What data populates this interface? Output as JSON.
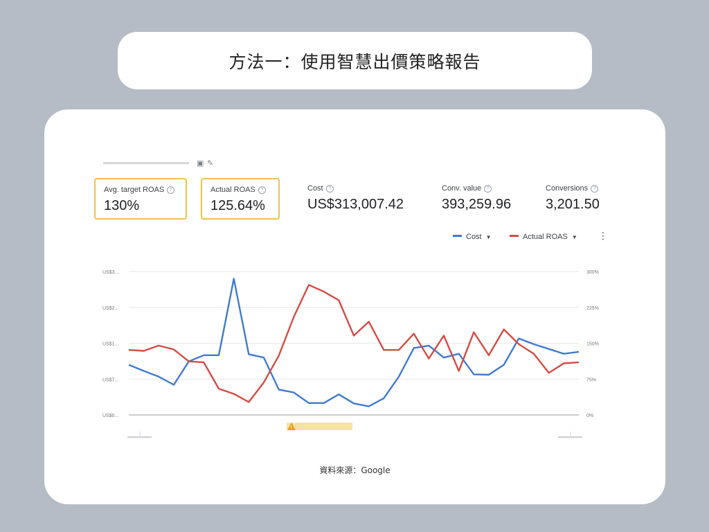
{
  "header": {
    "title": "方法一：使用智慧出價策略報告"
  },
  "icons": {
    "save": "save-icon",
    "edit": "pencil-icon",
    "help": "question-circle-icon",
    "warning": "warning-icon",
    "more": "more-vert-icon"
  },
  "metrics": [
    {
      "label": "Avg. target ROAS",
      "value": "130%",
      "highlighted": true
    },
    {
      "label": "Actual ROAS",
      "value": "125.64%",
      "highlighted": true
    },
    {
      "label": "Cost",
      "value": "US$313,007.42",
      "highlighted": false
    },
    {
      "label": "Conv. value",
      "value": "393,259.96",
      "highlighted": false
    },
    {
      "label": "Conversions",
      "value": "3,201.50",
      "highlighted": false
    }
  ],
  "legend": {
    "cost_label": "Cost",
    "roas_label": "Actual ROAS"
  },
  "colors": {
    "cost": "#3f7ad1",
    "roas": "#d64a43",
    "highlight": "#f3c04b",
    "warning": "#f5e3a6"
  },
  "chart_data": {
    "type": "line",
    "x": [
      1,
      2,
      3,
      4,
      5,
      6,
      7,
      8,
      9,
      10,
      11,
      12,
      13,
      14,
      15,
      16,
      17,
      18,
      19,
      20,
      21,
      22,
      23,
      24,
      25,
      26,
      27,
      28,
      29,
      30,
      31
    ],
    "y_left_ticks": [
      "US$0...",
      "US$7...",
      "US$1...",
      "US$2...",
      "US$3..."
    ],
    "y_right_ticks": [
      "0%",
      "75%",
      "150%",
      "225%",
      "300%"
    ],
    "ylim": [
      0,
      300
    ],
    "series": [
      {
        "name": "Cost",
        "axis": "left",
        "values": [
          105,
          92,
          80,
          63,
          112,
          125,
          125,
          285,
          127,
          120,
          53,
          47,
          25,
          25,
          43,
          24,
          18,
          35,
          80,
          140,
          145,
          120,
          128,
          85,
          84,
          105,
          160,
          148,
          138,
          128,
          132
        ]
      },
      {
        "name": "Actual ROAS",
        "axis": "right",
        "values": [
          136,
          134,
          145,
          137,
          112,
          110,
          55,
          44,
          27,
          68,
          124,
          205,
          272,
          258,
          240,
          166,
          195,
          136,
          136,
          170,
          118,
          166,
          92,
          173,
          125,
          179,
          148,
          128,
          88,
          108,
          110
        ]
      }
    ]
  },
  "source": {
    "text": "資料來源：Google"
  }
}
